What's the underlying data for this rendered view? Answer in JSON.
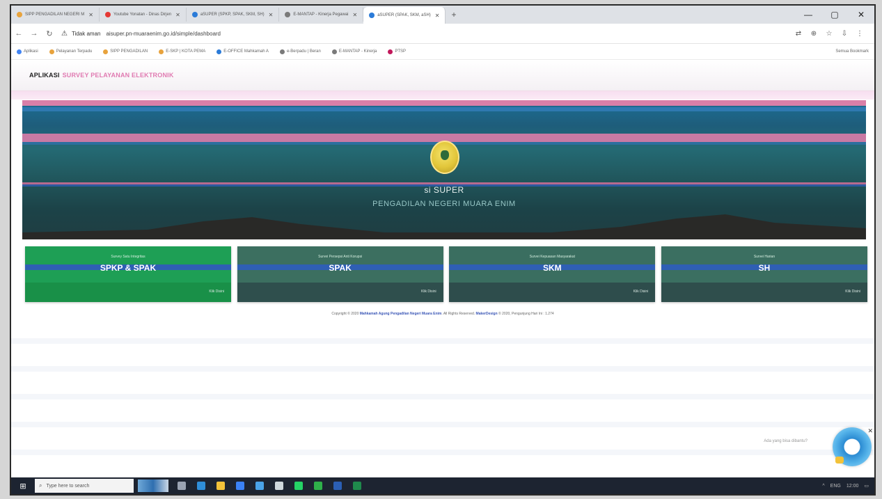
{
  "browser": {
    "tabs": [
      {
        "label": "SIPP PENGADILAN NEGERI M",
        "color": "#e8a33d"
      },
      {
        "label": "Youtube Yonatan - Dinas Dirjen",
        "color": "#e53935"
      },
      {
        "label": "aSUPER (SPKP, SPAK, SKM, SH)",
        "color": "#2b7bd8"
      },
      {
        "label": "E-MANTAP - Kinerja Pegawai",
        "color": "#7a7a7a"
      },
      {
        "label": "aSUPER (SPAK, SKM, aSH)",
        "color": "#2b7bd8",
        "active": true
      }
    ],
    "new_tab": "+",
    "window_controls": [
      "—",
      "▢",
      "✕"
    ],
    "address": {
      "security_label": "Tidak aman",
      "url": "aisuper.pn-muaraenim.go.id/simple/dashboard"
    },
    "bookmarks": [
      {
        "label": "Aplikasi",
        "color": "#4285f4"
      },
      {
        "label": "Pelayanan Terpadu",
        "color": "#e8a33d"
      },
      {
        "label": "SIPP PENGADILAN",
        "color": "#e8a33d"
      },
      {
        "label": "E-SKP | KOTA PEMA",
        "color": "#e8a33d"
      },
      {
        "label": "E-OFFICE Mahkamah A",
        "color": "#2b7bd8"
      },
      {
        "label": "e-Berpadu | Beran",
        "color": "#7a7a7a"
      },
      {
        "label": "E-MANTAP - Kinerja",
        "color": "#7a7a7a"
      },
      {
        "label": "PTSP",
        "color": "#c2185b"
      }
    ],
    "bookmarks_right": "Semua Bookmark"
  },
  "app": {
    "title": "APLIKASI",
    "subtitle": "SURVEY PELAYANAN ELEKTRONIK",
    "hero_title": "si SUPER",
    "hero_subtitle": "PENGADILAN NEGERI MUARA ENIM"
  },
  "cards": [
    {
      "caption": "Survey Satu Integritas",
      "name": "SPKP & SPAK",
      "more": "Klik Disini"
    },
    {
      "caption": "Survei Persepsi Anti Korupsi",
      "name": "SPAK",
      "more": "Klik Disini"
    },
    {
      "caption": "Survei Kepuasan Masyarakat",
      "name": "SKM",
      "more": "Klik Disini"
    },
    {
      "caption": "Survei Harian",
      "name": "SH",
      "more": "Klik Disini"
    }
  ],
  "footer": {
    "prefix": "Copyright © 2020",
    "org": "Mahkamah Agung Pengadilan Negeri Muara Enim",
    "middle": ". All Rights Reserved. ",
    "design": "MakerDesign",
    "suffix": " © 2020, Pengunjung Hari Ini : 1.274"
  },
  "chat": {
    "text": "Ada yang bisa dibantu?",
    "close": "✕"
  },
  "taskbar": {
    "search_placeholder": "Type here to search",
    "icons": [
      {
        "name": "task-view-icon",
        "color": "#9aa3b2"
      },
      {
        "name": "edge-icon",
        "color": "#2f8ed9"
      },
      {
        "name": "file-explorer-icon",
        "color": "#f2c23a"
      },
      {
        "name": "store-icon",
        "color": "#3b82f6"
      },
      {
        "name": "mail-icon",
        "color": "#4aa3e8"
      },
      {
        "name": "chrome-icon",
        "color": "#cfd8dc"
      },
      {
        "name": "whatsapp-icon",
        "color": "#25d366"
      },
      {
        "name": "photos-icon",
        "color": "#2fb04a"
      },
      {
        "name": "word-icon",
        "color": "#2b5fb4"
      },
      {
        "name": "excel-icon",
        "color": "#1f8a4c"
      }
    ],
    "tray": [
      "^",
      "ENG",
      "12:00",
      "▭"
    ]
  }
}
